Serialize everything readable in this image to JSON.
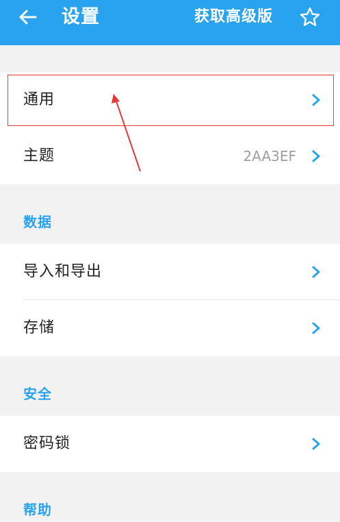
{
  "appbar": {
    "title": "设置",
    "premium_label": "获取高级版",
    "back_icon": "arrow-left-icon",
    "star_icon": "star-outline-icon",
    "color": "#2AA3EF"
  },
  "groups": {
    "general": {
      "rows": [
        {
          "label": "通用"
        },
        {
          "label": "主题",
          "value": "2AA3EF"
        }
      ]
    },
    "data": {
      "header": "数据",
      "rows": [
        {
          "label": "导入和导出"
        },
        {
          "label": "存储"
        }
      ]
    },
    "security": {
      "header": "安全",
      "rows": [
        {
          "label": "密码锁"
        }
      ]
    },
    "help": {
      "header": "帮助"
    }
  },
  "annotation": {
    "highlight_color": "#E53935",
    "target": "通用"
  }
}
